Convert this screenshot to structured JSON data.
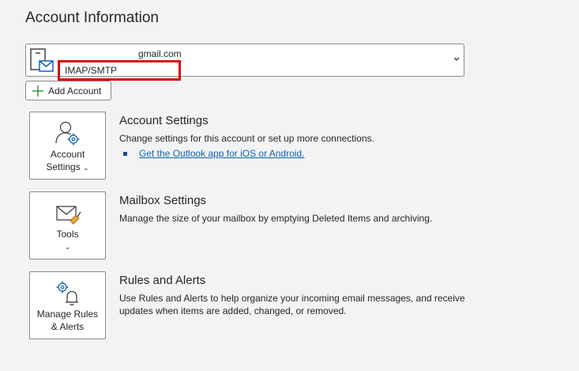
{
  "page": {
    "title": "Account Information"
  },
  "account": {
    "email": "gmail.com",
    "type": "IMAP/SMTP"
  },
  "add_account": {
    "label": "Add Account"
  },
  "sections": {
    "account_settings": {
      "tile_label_line1": "Account",
      "tile_label_line2": "Settings",
      "caret": "⌄",
      "title": "Account Settings",
      "description": "Change settings for this account or set up more connections.",
      "link": "Get the Outlook app for iOS or Android."
    },
    "mailbox_settings": {
      "tile_label": "Tools",
      "caret": "⌄",
      "title": "Mailbox Settings",
      "description": "Manage the size of your mailbox by emptying Deleted Items and archiving."
    },
    "rules_alerts": {
      "tile_label_line1": "Manage Rules",
      "tile_label_line2": "& Alerts",
      "title": "Rules and Alerts",
      "description": "Use Rules and Alerts to help organize your incoming email messages, and receive updates when items are added, changed, or removed."
    }
  },
  "colors": {
    "accent": "#1060b5",
    "highlight_border": "#d90c0c",
    "background": "#f3f3f3"
  }
}
